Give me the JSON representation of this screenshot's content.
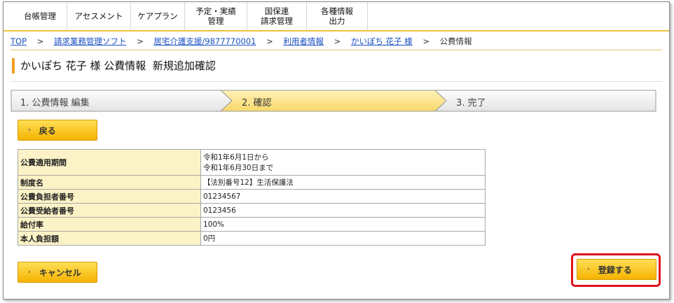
{
  "nav": {
    "items": [
      {
        "label": "台帳管理"
      },
      {
        "label": "アセスメント"
      },
      {
        "label": "ケアプラン"
      },
      {
        "label": "予定・実績\n管理"
      },
      {
        "label": "国保連\n請求管理"
      },
      {
        "label": "各種情報\n出力"
      }
    ]
  },
  "breadcrumb": {
    "top": "TOP",
    "sep": ">",
    "items": [
      "請求業務管理ソフト",
      "居宅介護支援/9877770001",
      "利用者情報",
      "かいぽち 花子 様"
    ],
    "current": "公費情報"
  },
  "page": {
    "title": "かいぽち 花子 様 公費情報  新規追加確認"
  },
  "steps": [
    {
      "label": "1. 公費情報 編集",
      "active": false
    },
    {
      "label": "2. 確認",
      "active": true
    },
    {
      "label": "3. 完了",
      "active": false
    }
  ],
  "buttons": {
    "back": "戻る",
    "cancel": "キャンセル",
    "register": "登録する",
    "arrow": "›"
  },
  "table": {
    "rows": [
      {
        "label": "公費適用期間",
        "value1": "令和1年6月1日から",
        "value2": "令和1年6月30日まで"
      },
      {
        "label": "制度名",
        "value1": "【法別番号12】生活保護法"
      },
      {
        "label": "公費負担者番号",
        "value1": "01234567"
      },
      {
        "label": "公費受給者番号",
        "value1": "0123456"
      },
      {
        "label": "給付率",
        "value1": "100%"
      },
      {
        "label": "本人負担額",
        "value1": "0円"
      }
    ]
  },
  "colors": {
    "accent": "#f5b300",
    "active_step": "#fbe49a",
    "highlight": "#e0141c"
  }
}
